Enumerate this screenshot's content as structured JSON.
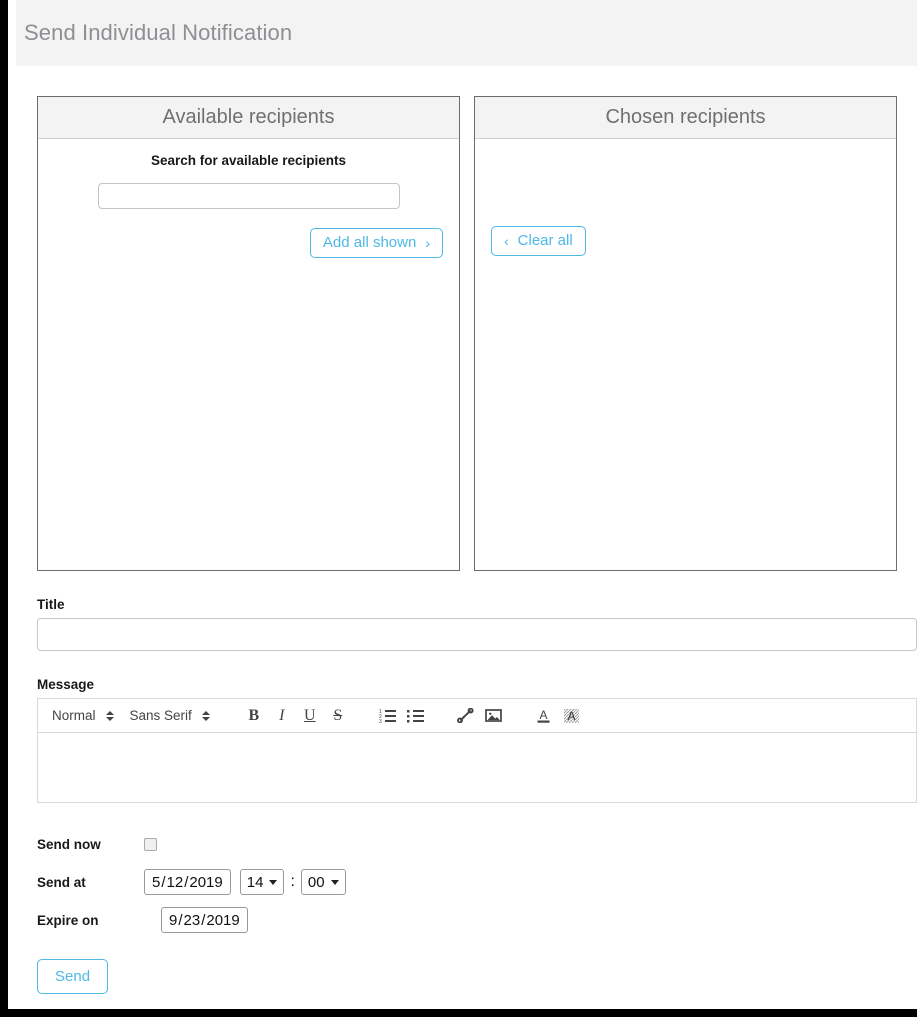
{
  "header": {
    "title": "Send Individual Notification"
  },
  "available_panel": {
    "heading": "Available recipients",
    "search_label": "Search for available recipients",
    "search_value": "",
    "search_placeholder": "",
    "add_all_label": "Add all shown",
    "add_all_chevron": "›"
  },
  "chosen_panel": {
    "heading": "Chosen recipients",
    "clear_all_label": "Clear all",
    "clear_all_chevron": "‹"
  },
  "form": {
    "title_label": "Title",
    "title_value": "",
    "title_placeholder": "",
    "message_label": "Message",
    "message_value": ""
  },
  "editor_toolbar": {
    "block_format": "Normal",
    "font_family": "Sans Serif",
    "bold": "B",
    "italic": "I",
    "underline": "U",
    "strike": "S",
    "icons": {
      "ordered_list": "ordered-list-icon",
      "bullet_list": "bullet-list-icon",
      "link": "link-icon",
      "image": "image-icon",
      "text_color": "text-color-icon",
      "background_color": "background-color-icon"
    }
  },
  "schedule": {
    "send_now_label": "Send now",
    "send_now_checked": false,
    "send_at_label": "Send at",
    "send_at_date": {
      "month": "5",
      "day": "12",
      "year": "2019",
      "separator": "/"
    },
    "send_at_hour": "14",
    "time_separator": ":",
    "send_at_minute": "00",
    "expire_on_label": "Expire on",
    "expire_on_date": {
      "month": "9",
      "day": "23",
      "year": "2019",
      "separator": "/"
    }
  },
  "actions": {
    "send_label": "Send"
  },
  "colors": {
    "accent": "#4cb9e7",
    "header_bg": "#f3f3f3",
    "header_text": "#8d8f93",
    "panel_head_text": "#6f7072",
    "frame": "#000000"
  }
}
